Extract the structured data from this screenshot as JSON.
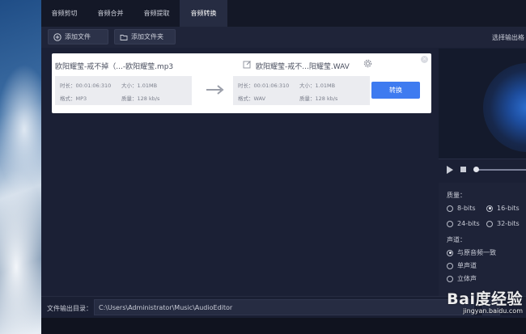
{
  "tabs": [
    {
      "label": "音频剪切"
    },
    {
      "label": "音频合并"
    },
    {
      "label": "音频提取"
    },
    {
      "label": "音频转换"
    }
  ],
  "toolbar": {
    "add_file": "添加文件",
    "add_folder": "添加文件夹",
    "output_label": "选择输出格"
  },
  "file": {
    "source_name": "欧阳耀莹-戒不掉（...-欧阳耀莹.mp3",
    "target_name": "欧阳耀莹-戒不...阳耀莹.WAV",
    "source": {
      "duration": "时长：00:01:06:310",
      "size": "大小：1.01MB",
      "format": "格式：MP3",
      "quality": "质量：128 kb/s"
    },
    "target": {
      "duration": "时长：00:01:06:310",
      "size": "大小：1.01MB",
      "format": "格式：WAV",
      "quality": "质量：128 kb/s"
    },
    "convert": "转换"
  },
  "settings": {
    "quality_label": "质量：",
    "bits": [
      {
        "label": "8-bits",
        "selected": false
      },
      {
        "label": "16-bits",
        "selected": true
      },
      {
        "label": "24-bits",
        "selected": false
      },
      {
        "label": "32-bits",
        "selected": false
      }
    ],
    "channel_label": "声道：",
    "channels": [
      {
        "label": "与原音频一致",
        "selected": true
      },
      {
        "label": "单声道",
        "selected": false
      },
      {
        "label": "立体声",
        "selected": false
      }
    ]
  },
  "bottom": {
    "output_dir_label": "文件输出目录：",
    "output_path": "C:\\Users\\Administrator\\Music\\AudioEditor"
  },
  "watermark": {
    "logo": "Bai度经验",
    "url": "jingyan.baidu.com"
  },
  "colors": {
    "accent": "#3e7bf0",
    "background": "#1b2035"
  }
}
